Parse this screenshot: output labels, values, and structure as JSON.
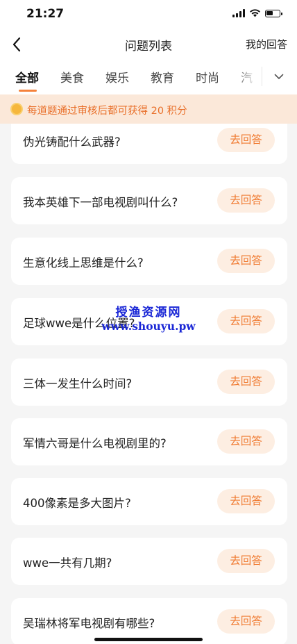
{
  "status_bar": {
    "time": "21:27",
    "icons": [
      "signal-icon",
      "wifi-icon",
      "battery-icon"
    ],
    "battery_level": 0.55
  },
  "nav": {
    "back_icon": "chevron-left-icon",
    "title": "问题列表",
    "right_label": "我的回答"
  },
  "tabs": {
    "items": [
      {
        "label": "全部",
        "active": true
      },
      {
        "label": "美食",
        "active": false
      },
      {
        "label": "娱乐",
        "active": false
      },
      {
        "label": "教育",
        "active": false
      },
      {
        "label": "时尚",
        "active": false
      },
      {
        "label": "汽",
        "active": false
      }
    ],
    "dropdown_icon": "chevron-down-icon"
  },
  "notice": {
    "icon": "coin-icon",
    "text": "每道题通过审核后都可获得 20 积分"
  },
  "questions": [
    {
      "text": "伪光铸配什么武器?",
      "button": "去回答"
    },
    {
      "text": "我本英雄下一部电视剧叫什么?",
      "button": "去回答"
    },
    {
      "text": "生意化线上思维是什么?",
      "button": "去回答"
    },
    {
      "text": "足球wwe是什么位置?",
      "button": "去回答"
    },
    {
      "text": "三体一发生什么时间?",
      "button": "去回答"
    },
    {
      "text": "军情六哥是什么电视剧里的?",
      "button": "去回答"
    },
    {
      "text": "400像素是多大图片?",
      "button": "去回答"
    },
    {
      "text": "wwe一共有几期?",
      "button": "去回答"
    },
    {
      "text": "吴瑞林将军电视剧有哪些?",
      "button": "去回答"
    }
  ],
  "watermark": {
    "line1": "授渔资源网",
    "line2": "www.shouyu.pw"
  },
  "colors": {
    "accent": "#f5823b",
    "notice_bg": "#fbe8d9",
    "notice_text": "#e9712c",
    "button_bg": "#fdeee2",
    "button_text": "#f0792f",
    "page_bg": "#f5f5f5",
    "watermark": "#1a27d6"
  }
}
